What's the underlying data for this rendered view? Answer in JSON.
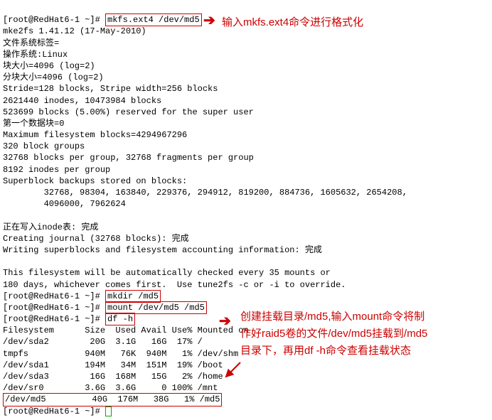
{
  "prompt": "[root@RedHat6-1 ~]# ",
  "cmd": {
    "mkfs": "mkfs.ext4 /dev/md5",
    "mkdir": "mkdir /md5",
    "mount": "mount /dev/md5 /md5",
    "df": "df -h"
  },
  "out": {
    "mke2fs": "mke2fs 1.41.12 (17-May-2010)",
    "fslabel": "文件系统标签=",
    "os": "操作系统:Linux",
    "bsize": "块大小=4096 (log=2)",
    "fsize": "分块大小=4096 (log=2)",
    "stride": "Stride=128 blocks, Stripe width=256 blocks",
    "inodes": "2621440 inodes, 10473984 blocks",
    "reserved": "523699 blocks (5.00%) reserved for the super user",
    "firstdata": "第一个数据块=0",
    "maxfs": "Maximum filesystem blocks=4294967296",
    "groups": "320 block groups",
    "bpg": "32768 blocks per group, 32768 fragments per group",
    "ipg": "8192 inodes per group",
    "sb_hdr": "Superblock backups stored on blocks:",
    "sb1": "        32768, 98304, 163840, 229376, 294912, 819200, 884736, 1605632, 2654208,",
    "sb2": "        4096000, 7962624",
    "blank": "",
    "writing_inode": "正在写入inode表: 完成",
    "journal": "Creating journal (32768 blocks): 完成",
    "writing_sb": "Writing superblocks and filesystem accounting information: 完成",
    "autochk1": "This filesystem will be automatically checked every 35 mounts or",
    "autochk2": "180 days, whichever comes first.  Use tune2fs -c or -i to override."
  },
  "df": {
    "hdr": "Filesystem      Size  Used Avail Use% Mounted on",
    "sda2": "/dev/sda2        20G  3.1G   16G  17% /",
    "tmpfs": "tmpfs           940M   76K  940M   1% /dev/shm",
    "sda1": "/dev/sda1       194M   34M  151M  19% /boot",
    "sda3": "/dev/sda3        16G  168M   15G   2% /home",
    "sr0": "/dev/sr0        3.6G  3.6G     0 100% /mnt",
    "md5": "/dev/md5         40G  176M   38G   1% /md5"
  },
  "annot": {
    "a1": "输入mkfs.ext4命令进行格式化",
    "a2_l1": "创建挂载目录/md5,输入mount命令将制",
    "a2_l2": "作好raid5卷的文件/dev/md5挂载到/md5",
    "a2_l3": "目录下，再用df -h命令查看挂载状态"
  }
}
